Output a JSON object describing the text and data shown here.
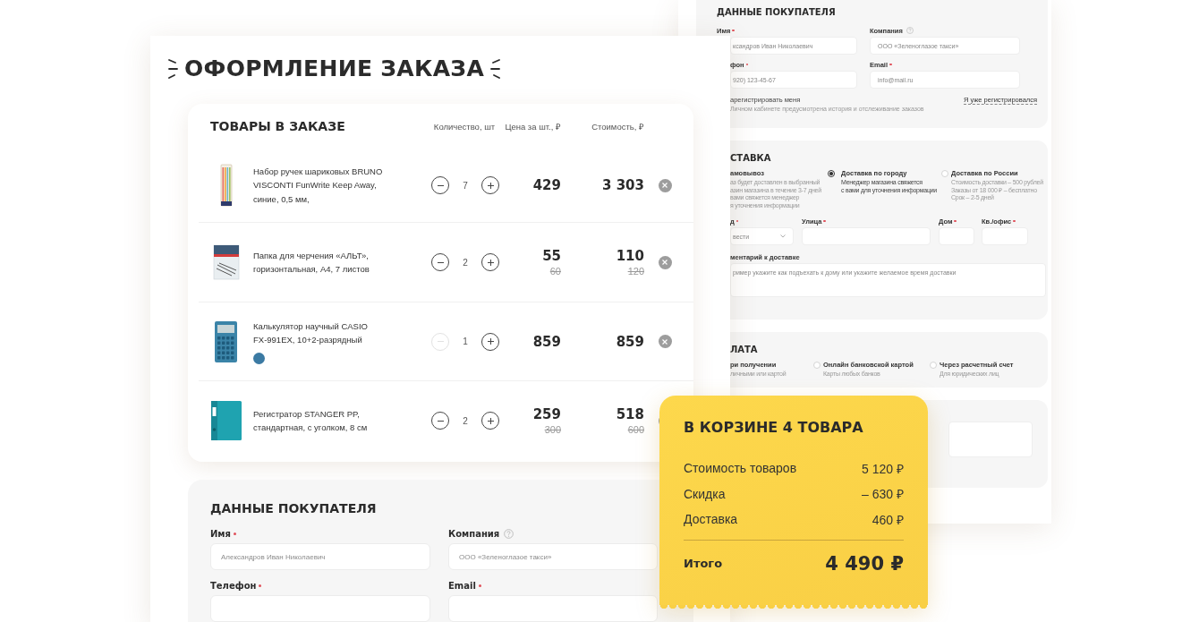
{
  "back_page": {
    "buyer": {
      "title": "ДАННЫЕ ПОКУПАТЕЛЯ",
      "fields": [
        {
          "label": "Имя",
          "required": true,
          "placeholder": "ксандров Иван Николаевич"
        },
        {
          "label": "Компания",
          "help": true,
          "placeholder": "ООО «Зеленоглазое такси»"
        },
        {
          "label": "фон",
          "required": true,
          "placeholder": "920) 123-45-67"
        },
        {
          "label": "Email",
          "required": true,
          "placeholder": "info@mail.ru"
        }
      ],
      "register": {
        "label": "арегистрировать меня",
        "note": "Личном кабинете предусмотрена история и отслеживание заказов"
      },
      "login_link": "Я уже регистрировался"
    },
    "delivery": {
      "title": "СТАВКА",
      "options": [
        {
          "label": "амовывоз",
          "description": [
            "аз будет доставлен в выбранный",
            "азин магазина в течение 3-7 дней",
            "вами свяжется менеджер",
            "я уточнения информации"
          ]
        },
        {
          "label": "Доставка по городу",
          "selected": true,
          "description": [
            "Менеджер магазина свяжется",
            "с вами для уточнения информации"
          ]
        },
        {
          "label": "Доставка по России",
          "selected": false,
          "description": [
            "Стоимость доставки – 500 рублей",
            "Заказы от 18 000 ₽ – бесплатно",
            "Срок – 2-5 дней"
          ]
        }
      ],
      "fields": [
        {
          "kind": "select",
          "label": "д",
          "required": true,
          "value": "вести"
        },
        {
          "kind": "text",
          "label": "Улица",
          "required": true
        },
        {
          "kind": "text",
          "label": "Дом",
          "required": true
        },
        {
          "kind": "text",
          "label": "Кв./офис",
          "required": true
        }
      ],
      "comment": {
        "label": "ментарий к доставке",
        "placeholder": "ример укажите как подъехать к дому или укажите желаемое время доставки"
      }
    },
    "payment": {
      "title": "ЛАТА",
      "options": [
        {
          "label": "ри получении",
          "description": "личными или картой"
        },
        {
          "label": "Онлайн банковской картой",
          "selected": false,
          "description": "Карты любых банков"
        },
        {
          "label": "Через расчетный счет",
          "selected": false,
          "description": "Для юридических лиц"
        }
      ]
    }
  },
  "front_page": {
    "title": "ОФОРМЛЕНИЕ ЗАКАЗА",
    "cart": {
      "title": "ТОВАРЫ В ЗАКАЗЕ",
      "columns": [
        "Количество, шт",
        "Цена за шт., ₽",
        "Стоимость, ₽"
      ],
      "items": [
        {
          "kind": "pens",
          "name": "Набор ручек шариковых BRUNO VISCONTI FunWrite Keep Away, синие, 0,5 мм,",
          "quantity": "7",
          "minus_disabled": false,
          "price": "429",
          "total": "3 303"
        },
        {
          "kind": "folder",
          "name": "Папка для черчения «АЛЬТ», горизонтальная, А4, 7 листов",
          "quantity": "2",
          "minus_disabled": false,
          "price": "55",
          "old_price": "60",
          "total": "110",
          "old_total": "120"
        },
        {
          "kind": "calculator",
          "name": "Калькулятор научный CASIO FX-991EX, 10+2-разрядный",
          "color": "#3b7aa3",
          "quantity": "1",
          "minus_disabled": true,
          "price": "859",
          "total": "859"
        },
        {
          "kind": "binder",
          "name": "Регистратор STANGER PP, стандартная, с уголком, 8 см",
          "quantity": "2",
          "minus_disabled": false,
          "price": "259",
          "old_price": "300",
          "total": "518",
          "old_total": "600"
        }
      ]
    },
    "buyer": {
      "title": "ДАННЫЕ ПОКУПАТЕЛЯ",
      "fields": [
        {
          "label": "Имя",
          "required": true,
          "placeholder": "Александров Иван Николаевич"
        },
        {
          "label": "Компания",
          "help": true,
          "placeholder": "ООО «Зеленоглазое такси»"
        },
        {
          "label": "Телефон",
          "required": true
        },
        {
          "label": "Email",
          "required": true
        }
      ]
    }
  },
  "summary": {
    "title": "В КОРЗИНЕ 4 ТОВАРА",
    "rows": [
      {
        "label": "Стоимость товаров",
        "value": "5 120 ₽"
      },
      {
        "label": "Скидка",
        "value": "– 630 ₽"
      },
      {
        "label": "Доставка",
        "value": "460 ₽"
      }
    ],
    "total": {
      "label": "Итого",
      "value": "4 490 ₽"
    }
  }
}
